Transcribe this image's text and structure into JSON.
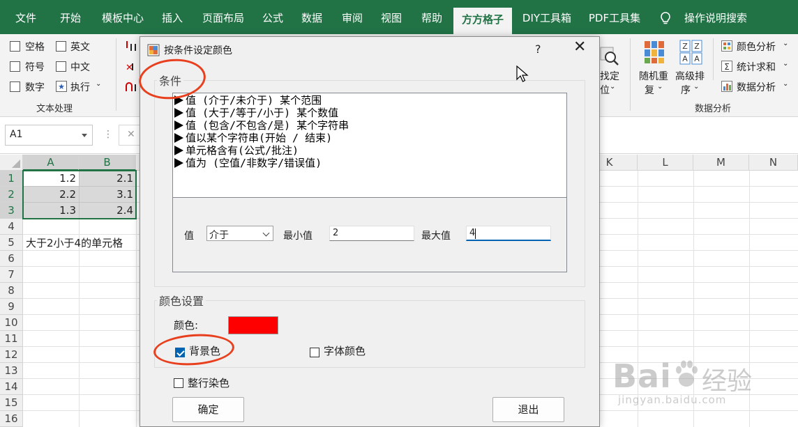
{
  "ribbon_tabs": [
    "文件",
    "开始",
    "模板中心",
    "插入",
    "页面布局",
    "公式",
    "数据",
    "审阅",
    "视图",
    "帮助",
    "方方格子",
    "DIY工具箱",
    "PDF工具集"
  ],
  "search_tab": "操作说明搜索",
  "ribbon": {
    "text_group": {
      "items": [
        "空格",
        "英文",
        "符号",
        "中文",
        "数字",
        "执行"
      ],
      "label": "文本处理"
    },
    "find_label_1": "找定",
    "find_label_2": "位",
    "random_label_1": "随机重",
    "random_label_2": "复",
    "sort_label_1": "高级排",
    "sort_label_2": "序",
    "color_analysis": "颜色分析",
    "stat_sum": "统计求和",
    "data_analysis_btn": "数据分析",
    "data_group_label": "数据分析"
  },
  "namebox": "A1",
  "columns": [
    "A",
    "B",
    "K",
    "L",
    "M",
    "N"
  ],
  "rows": [
    "1",
    "2",
    "3",
    "4",
    "5",
    "6",
    "7",
    "8",
    "9",
    "10",
    "11",
    "12",
    "13",
    "14",
    "15",
    "16"
  ],
  "cells": {
    "a1": "1.2",
    "b1": "2.1",
    "a2": "2.2",
    "b2": "3.1",
    "a3": "1.3",
    "b3": "2.4",
    "a5": "大于2小于4的单元格"
  },
  "dialog": {
    "title": "按条件设定颜色",
    "help": "?",
    "close": "✕",
    "conditions_legend": "条件",
    "conditions": [
      "值 (介于/未介于) 某个范围",
      "值 (大于/等于/小于) 某个数值",
      "值 (包含/不包含/是) 某个字符串",
      "值以某个字符串(开始 / 结束)",
      "单元格含有(公式/批注)",
      "值为 (空值/非数字/错误值)"
    ],
    "value_label": "值",
    "operator": "介于",
    "min_label": "最小值",
    "min_value": "2",
    "max_label": "最大值",
    "max_value": "4",
    "color_legend": "颜色设置",
    "color_label": "颜色:",
    "swatch_color": "#ff0000",
    "bg_color_label": "背景色",
    "bg_color_checked": true,
    "font_color_label": "字体颜色",
    "whole_row_label": "整行染色",
    "ok_label": "确定",
    "exit_label": "退出"
  },
  "watermark": {
    "brand": "Bai",
    "brand_cn": "经验",
    "url": "jingyan.baidu.com"
  }
}
